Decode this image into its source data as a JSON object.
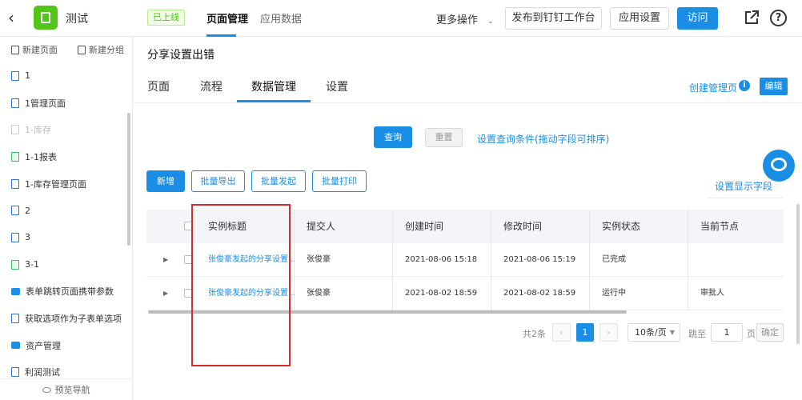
{
  "header": {
    "back_icon": "chevron-left-icon",
    "app_name": "测试",
    "status_badge": "已上线",
    "tabs": [
      {
        "label": "页面管理",
        "active": true
      },
      {
        "label": "应用数据",
        "active": false
      }
    ],
    "more_actions": "更多操作",
    "publish_label": "发布到钉钉工作台",
    "app_settings_label": "应用设置",
    "visit_label": "访问",
    "accent_color": "#1a8de5",
    "logo_color": "#52c41a"
  },
  "sidebar": {
    "new_page": "新建页面",
    "new_group": "新建分组",
    "items": [
      {
        "label": "1",
        "icon": "doc-icon",
        "disabled": false
      },
      {
        "label": "1管理页面",
        "icon": "form-icon",
        "disabled": false
      },
      {
        "label": "1-库存",
        "icon": "doc-icon",
        "disabled": true
      },
      {
        "label": "1-1报表",
        "icon": "report-icon",
        "disabled": false
      },
      {
        "label": "1-库存管理页面",
        "icon": "form-icon",
        "disabled": false
      },
      {
        "label": "2",
        "icon": "doc-icon",
        "disabled": false
      },
      {
        "label": "3",
        "icon": "doc-icon",
        "disabled": false
      },
      {
        "label": "3-1",
        "icon": "report-icon",
        "disabled": false
      },
      {
        "label": "表单跳转页面携带参数",
        "icon": "folder-icon",
        "disabled": false
      },
      {
        "label": "获取选项作为子表单选项",
        "icon": "doc-icon",
        "disabled": false
      },
      {
        "label": "资产管理",
        "icon": "folder-icon",
        "disabled": false
      },
      {
        "label": "利润测试",
        "icon": "doc-icon",
        "disabled": false
      }
    ],
    "footer": "预览导航"
  },
  "main": {
    "page_title": "分享设置出错",
    "tabs": [
      {
        "label": "页面",
        "active": false
      },
      {
        "label": "流程",
        "active": false
      },
      {
        "label": "数据管理",
        "active": true
      },
      {
        "label": "设置",
        "active": false
      }
    ],
    "create_manage_label": "创建管理页",
    "info_icon": "i",
    "edit_label": "编辑",
    "query_label": "查询",
    "reset_label": "重置",
    "query_conditions_link": "设置查询条件(拖动字段可排序)",
    "toolbar": {
      "add": "新增",
      "batch_export": "批量导出",
      "batch_launch": "批量发起",
      "batch_print": "批量打印",
      "display_fields": "设置显示字段"
    }
  },
  "table": {
    "columns": [
      "实例标题",
      "提交人",
      "创建时间",
      "修改时间",
      "实例状态",
      "当前节点"
    ],
    "rows": [
      {
        "title": "张俊豪发起的分享设置...",
        "submitter": "张俊豪",
        "created": "2021-08-06 15:18",
        "modified": "2021-08-06 15:19",
        "status": "已完成",
        "node": ""
      },
      {
        "title": "张俊豪发起的分享设置...",
        "submitter": "张俊豪",
        "created": "2021-08-02 18:59",
        "modified": "2021-08-02 18:59",
        "status": "运行中",
        "node": "审批人"
      }
    ]
  },
  "pagination": {
    "total": "共2条",
    "prev": "‹",
    "current_page": "1",
    "next": "›",
    "page_size": "10条/页",
    "goto_label": "跳至",
    "goto_value": "1",
    "page_suffix": "页",
    "confirm_label": "确定"
  }
}
